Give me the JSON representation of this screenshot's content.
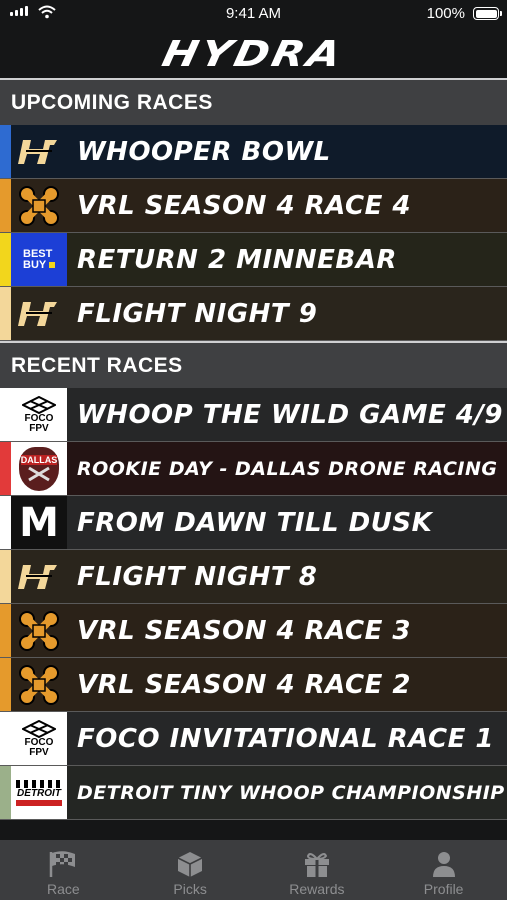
{
  "status": {
    "time": "9:41 AM",
    "battery": "100%"
  },
  "brand": {
    "logo_text": "HYDRA"
  },
  "sections": {
    "upcoming": {
      "title": "UPCOMING RACES"
    },
    "recent": {
      "title": "RECENT RACES"
    }
  },
  "upcoming": [
    {
      "name": "WHOOPER BOWL",
      "logo": "hydra-logo",
      "stripe": "#2e6bd1",
      "bg": "#0f1b2a"
    },
    {
      "name": "VRL SEASON 4 RACE 4",
      "logo": "drone-logo",
      "stripe": "#e59a2c",
      "bg": "#2b2218"
    },
    {
      "name": "RETURN 2 MINNEBAR",
      "logo": "best-buy-logo",
      "logo_text": "BEST BUY",
      "stripe": "#f2d61c",
      "bg": "#25251a"
    },
    {
      "name": "FLIGHT NIGHT 9",
      "logo": "hydra-logo",
      "stripe": "#f3d79a",
      "bg": "#2a251c"
    }
  ],
  "recent": [
    {
      "name": "WHOOP THE WILD GAME 4/9",
      "logo": "foco-fpv-logo",
      "logo_text": "FOCO FPV",
      "stripe": "#ffffff",
      "bg": "#262728"
    },
    {
      "name": "ROOKIE DAY - DALLAS DRONE RACING",
      "logo": "dallas-logo",
      "logo_text": "DALLAS",
      "stripe": "#e23a3a",
      "bg": "#241414"
    },
    {
      "name": "FROM DAWN TILL DUSK",
      "logo": "m-logo",
      "logo_text": "M",
      "stripe": "#ffffff",
      "bg": "#262728"
    },
    {
      "name": "FLIGHT NIGHT 8",
      "logo": "hydra-logo",
      "stripe": "#f3d79a",
      "bg": "#2a251c"
    },
    {
      "name": "VRL SEASON 4 RACE 3",
      "logo": "drone-logo",
      "stripe": "#e59a2c",
      "bg": "#2b2218"
    },
    {
      "name": "VRL SEASON 4 RACE 2",
      "logo": "drone-logo",
      "stripe": "#e59a2c",
      "bg": "#2b2218"
    },
    {
      "name": "FOCO INVITATIONAL RACE 1",
      "logo": "foco-fpv-logo",
      "logo_text": "FOCO FPV",
      "stripe": "#ffffff",
      "bg": "#262728"
    },
    {
      "name": "DETROIT TINY WHOOP CHAMPIONSHIP",
      "logo": "detroit-logo",
      "logo_text": "DETROIT",
      "stripe": "#9bb08a",
      "bg": "#242623"
    }
  ],
  "tabs": [
    {
      "label": "Race",
      "icon": "checkered-flag-icon",
      "active": true
    },
    {
      "label": "Picks",
      "icon": "cube-icon",
      "active": false
    },
    {
      "label": "Rewards",
      "icon": "gift-icon",
      "active": false
    },
    {
      "label": "Profile",
      "icon": "person-icon",
      "active": false
    }
  ]
}
